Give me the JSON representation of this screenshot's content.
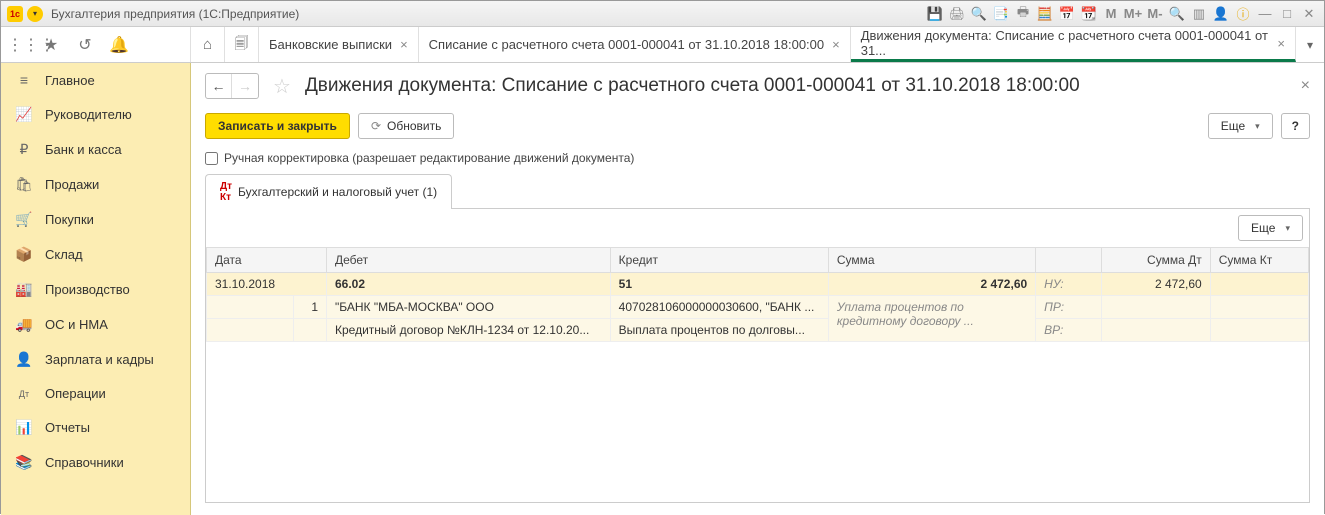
{
  "titlebar": {
    "app_title": "Бухгалтерия предприятия  (1С:Предприятие)",
    "m_buttons": [
      "M",
      "M+",
      "M-"
    ]
  },
  "tabs": [
    {
      "label": "Банковские выписки"
    },
    {
      "label": "Списание с расчетного счета 0001-000041 от 31.10.2018 18:00:00"
    },
    {
      "label": "Движения документа: Списание с расчетного счета 0001-000041 от 31..."
    }
  ],
  "sidebar": {
    "items": [
      {
        "icon": "≡",
        "label": "Главное"
      },
      {
        "icon": "📈",
        "label": "Руководителю"
      },
      {
        "icon": "₽",
        "label": "Банк и касса"
      },
      {
        "icon": "🛍",
        "label": "Продажи"
      },
      {
        "icon": "🛒",
        "label": "Покупки"
      },
      {
        "icon": "📦",
        "label": "Склад"
      },
      {
        "icon": "🏭",
        "label": "Производство"
      },
      {
        "icon": "🚚",
        "label": "ОС и НМА"
      },
      {
        "icon": "👤",
        "label": "Зарплата и кадры"
      },
      {
        "icon": "Дт",
        "label": "Операции"
      },
      {
        "icon": "📊",
        "label": "Отчеты"
      },
      {
        "icon": "📚",
        "label": "Справочники"
      }
    ]
  },
  "page": {
    "title": "Движения документа: Списание с расчетного счета 0001-000041 от 31.10.2018 18:00:00",
    "save_close": "Записать и закрыть",
    "refresh": "Обновить",
    "more": "Еще",
    "help": "?",
    "checkbox_label": "Ручная корректировка (разрешает редактирование движений документа)",
    "subtab": "Бухгалтерский и налоговый учет (1)"
  },
  "grid": {
    "headers": {
      "date": "Дата",
      "debit": "Дебет",
      "credit": "Кредит",
      "sum": "Сумма",
      "sum_dt": "Сумма Дт",
      "sum_kt": "Сумма Кт"
    },
    "row1": {
      "date": "31.10.2018",
      "debit": "66.02",
      "credit": "51",
      "sum": "2 472,60",
      "nu_label": "НУ:",
      "sum_dt": "2 472,60"
    },
    "row2": {
      "num": "1",
      "debit": "\"БАНК \"МБА-МОСКВА\" ООО",
      "credit": "407028106000000030600, \"БАНК ...",
      "sum": "Уплата процентов по кредитному договору ...",
      "pr_label": "ПР:"
    },
    "row3": {
      "debit": "Кредитный договор №КЛН-1234 от 12.10.20...",
      "credit": "Выплата процентов по долговы...",
      "vr_label": "ВР:"
    }
  }
}
